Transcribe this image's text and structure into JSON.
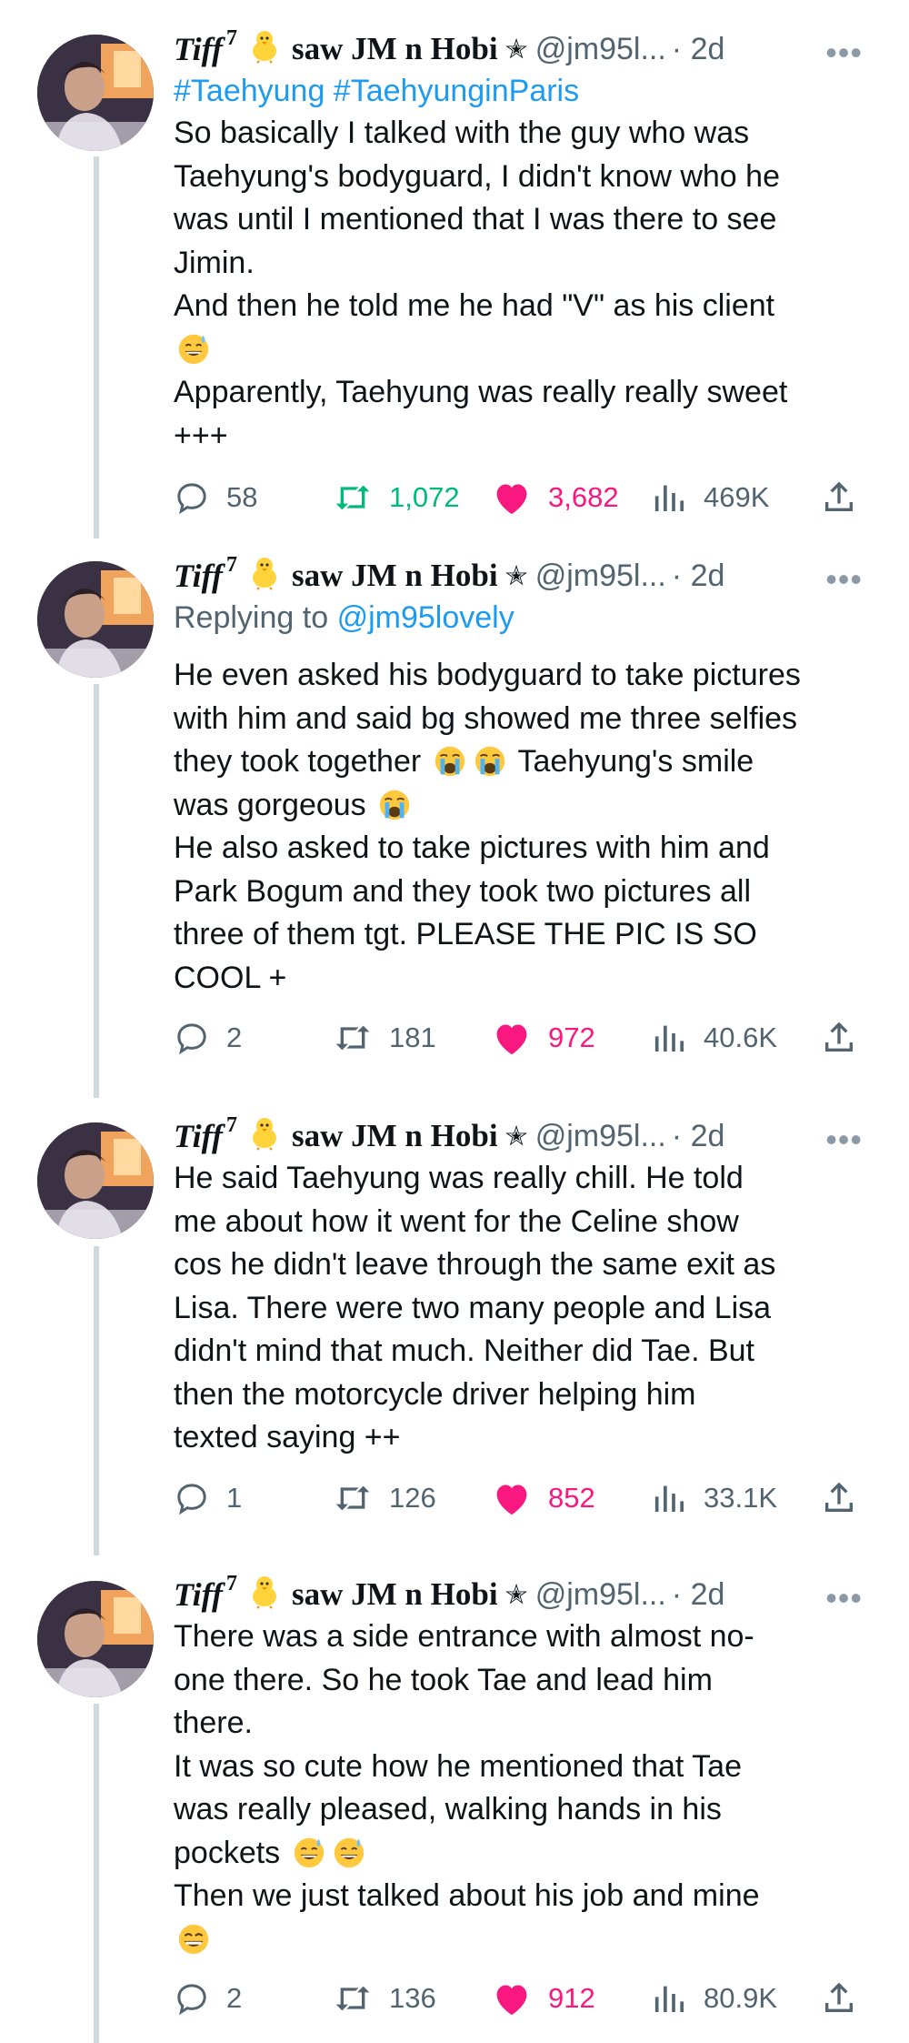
{
  "user": {
    "display_name": "Tiff",
    "superscript": "7",
    "nickname_suffix": "saw JM n Hobi",
    "star": "✭",
    "handle": "@jm95l...",
    "separator": "·",
    "more": "•••"
  },
  "colors": {
    "link": "#1d9bf0",
    "muted": "#536471",
    "retweet": "#00ba7c",
    "like": "#f91880",
    "thread_line": "#cfd9de"
  },
  "tweets": [
    {
      "time": "2d",
      "hashtags": "#Taehyung #TaehyunginParis",
      "text_a": "So basically I talked with the guy who was\nTaehyung's bodyguard, I didn't know who he\nwas until I mentioned that I was there to see\nJimin.\nAnd then he told me he had \"V\" as his client\n",
      "text_b": "\nApparently, Taehyung was really really sweet\n+++",
      "emoji_a": "grinning-face-with-sweat",
      "replies": "58",
      "retweets": "1,072",
      "likes": "3,682",
      "views": "469K"
    },
    {
      "time": "2d",
      "replying_label": "Replying to",
      "replying_handle": "@jm95lovely",
      "text_a": "He even asked his bodyguard to take pictures\nwith him and said bg showed me three selfies\nthey took together ",
      "text_b": " Taehyung's smile\nwas gorgeous ",
      "text_c": "\nHe also asked to take pictures with him and\nPark Bogum and they took two pictures all\nthree of them tgt. PLEASE THE PIC IS SO\nCOOL +",
      "emoji_a": "loudly-crying-face",
      "replies": "2",
      "retweets": "181",
      "likes": "972",
      "views": "40.6K"
    },
    {
      "time": "2d",
      "text_a": "He said Taehyung was really chill. He told\nme about how it went for the Celine show\ncos he didn't leave through the same exit as\nLisa. There were two many people and Lisa\ndidn't mind that much. Neither did Tae. But\nthen the motorcycle driver helping him\ntexted saying ++",
      "replies": "1",
      "retweets": "126",
      "likes": "852",
      "views": "33.1K"
    },
    {
      "time": "2d",
      "text_a": "There was a side entrance with almost no-\none there. So he took Tae and lead him\nthere.\nIt was so cute how he mentioned that Tae\nwas really pleased, walking hands in his\npockets ",
      "text_b": "\nThen we just talked about his job and mine\n",
      "emoji_a": "grinning-face-with-sweat",
      "emoji_b": "beaming-face-with-smiling-eyes",
      "replies": "2",
      "retweets": "136",
      "likes": "912",
      "views": "80.9K"
    }
  ]
}
